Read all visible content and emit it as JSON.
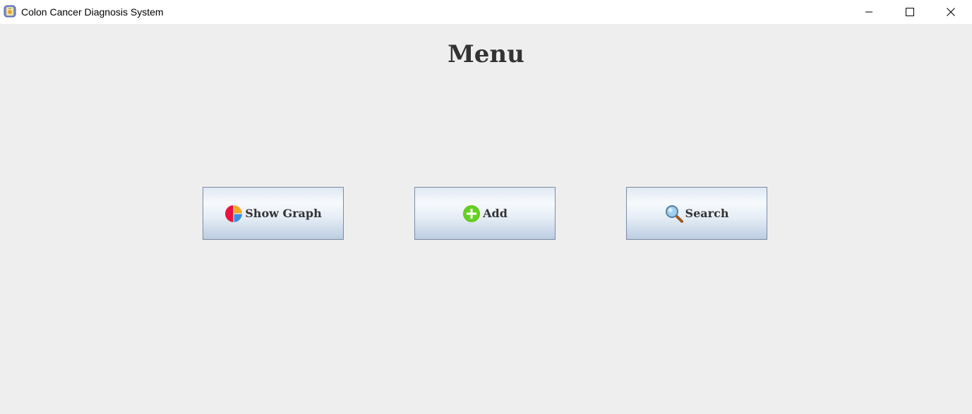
{
  "window": {
    "title": "Colon Cancer Diagnosis System",
    "icon": "app-icon",
    "controls": {
      "minimize": "minimize-icon",
      "maximize": "maximize-icon",
      "close": "close-icon"
    }
  },
  "main": {
    "heading": "Menu",
    "buttons": [
      {
        "label": "Show Graph",
        "icon": "pie-chart-icon"
      },
      {
        "label": "Add",
        "icon": "plus-circle-icon"
      },
      {
        "label": "Search",
        "icon": "magnifier-icon"
      }
    ]
  },
  "colors": {
    "background": "#eeeeee",
    "titlebar": "#ffffff",
    "button_border": "#7a8ba3",
    "text": "#333333"
  }
}
